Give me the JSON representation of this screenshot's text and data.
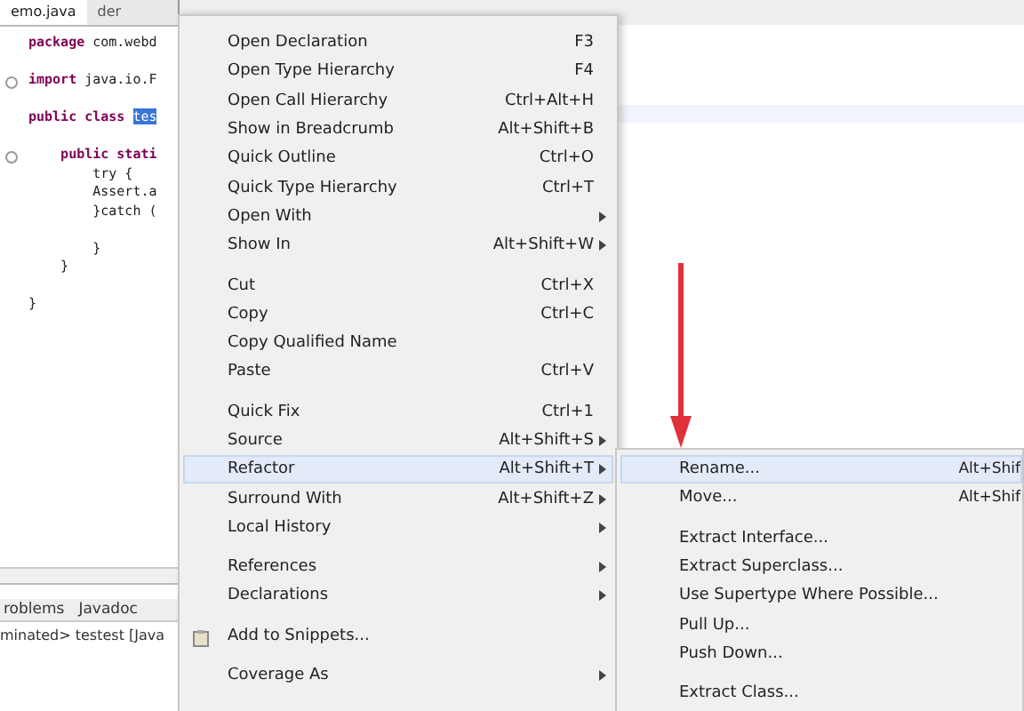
{
  "editor": {
    "tabs": [
      {
        "label": "emo.java",
        "selected": true
      },
      {
        "label": "der",
        "selected": false
      }
    ],
    "lines": [
      {
        "fold": false,
        "segments": [
          {
            "text": "package",
            "kind": "keyword"
          },
          {
            "text": " com.webd",
            "kind": "plain"
          }
        ]
      },
      {
        "kind": "blank"
      },
      {
        "fold": true,
        "segments": [
          {
            "text": "import",
            "kind": "keyword"
          },
          {
            "text": " java.io.F",
            "kind": "plain"
          }
        ]
      },
      {
        "kind": "blank"
      },
      {
        "fold": false,
        "segments": [
          {
            "text": "public class ",
            "kind": "keyword"
          },
          {
            "text": "tes",
            "kind": "selection"
          }
        ]
      },
      {
        "kind": "blank"
      },
      {
        "fold": true,
        "segments": [
          {
            "text": "    public stati",
            "kind": "keyword"
          }
        ]
      },
      {
        "fold": false,
        "segments": [
          {
            "text": "        try {",
            "kind": "plain"
          }
        ]
      },
      {
        "fold": false,
        "segments": [
          {
            "text": "        Assert.a",
            "kind": "plain"
          }
        ]
      },
      {
        "fold": false,
        "segments": [
          {
            "text": "        }catch (",
            "kind": "plain"
          }
        ]
      },
      {
        "kind": "blank"
      },
      {
        "fold": false,
        "segments": [
          {
            "text": "        }",
            "kind": "plain"
          }
        ]
      },
      {
        "fold": false,
        "segments": [
          {
            "text": "    }",
            "kind": "plain"
          }
        ]
      },
      {
        "kind": "blank"
      },
      {
        "fold": false,
        "segments": [
          {
            "text": "}",
            "kind": "plain"
          }
        ]
      }
    ]
  },
  "bottom_panel": {
    "tabs": [
      {
        "label": "roblems",
        "selected": false
      },
      {
        "label": "Javadoc",
        "selected": false
      }
    ],
    "console": "minated> testest [Java"
  },
  "context_menu": [
    {
      "kind": "item",
      "label": "Open Declaration",
      "shortcut": "F3",
      "submenu": false,
      "selected": false
    },
    {
      "kind": "item",
      "label": "Open Type Hierarchy",
      "shortcut": "F4",
      "submenu": false,
      "selected": false
    },
    {
      "kind": "item",
      "label": "Open Call Hierarchy",
      "shortcut": "Ctrl+Alt+H",
      "submenu": false,
      "selected": false
    },
    {
      "kind": "item",
      "label": "Show in Breadcrumb",
      "shortcut": "Alt+Shift+B",
      "submenu": false,
      "selected": false
    },
    {
      "kind": "item",
      "label": "Quick Outline",
      "shortcut": "Ctrl+O",
      "submenu": false,
      "selected": false
    },
    {
      "kind": "item",
      "label": "Quick Type Hierarchy",
      "shortcut": "Ctrl+T",
      "submenu": false,
      "selected": false
    },
    {
      "kind": "item",
      "label": "Open With",
      "submenu": true,
      "selected": false
    },
    {
      "kind": "item",
      "label": "Show In",
      "shortcut": "Alt+Shift+W",
      "submenu": true,
      "selected": false
    },
    {
      "kind": "separator"
    },
    {
      "kind": "item",
      "label": "Cut",
      "shortcut": "Ctrl+X",
      "submenu": false,
      "selected": false
    },
    {
      "kind": "item",
      "label": "Copy",
      "shortcut": "Ctrl+C",
      "submenu": false,
      "selected": false
    },
    {
      "kind": "item",
      "label": "Copy Qualified Name",
      "submenu": false,
      "selected": false
    },
    {
      "kind": "item",
      "label": "Paste",
      "shortcut": "Ctrl+V",
      "submenu": false,
      "selected": false
    },
    {
      "kind": "separator"
    },
    {
      "kind": "item",
      "label": "Quick Fix",
      "shortcut": "Ctrl+1",
      "submenu": false,
      "selected": false
    },
    {
      "kind": "item",
      "label": "Source",
      "shortcut": "Alt+Shift+S",
      "submenu": true,
      "selected": false
    },
    {
      "kind": "item",
      "label": "Refactor",
      "shortcut": "Alt+Shift+T",
      "submenu": true,
      "selected": true
    },
    {
      "kind": "item",
      "label": "Surround With",
      "shortcut": "Alt+Shift+Z",
      "submenu": true,
      "selected": false
    },
    {
      "kind": "item",
      "label": "Local History",
      "submenu": true,
      "selected": false
    },
    {
      "kind": "separator"
    },
    {
      "kind": "item",
      "label": "References",
      "submenu": true,
      "selected": false
    },
    {
      "kind": "item",
      "label": "Declarations",
      "submenu": true,
      "selected": false
    },
    {
      "kind": "separator"
    },
    {
      "kind": "icon_item",
      "label": "Add to Snippets...",
      "submenu": false,
      "selected": false
    },
    {
      "kind": "separator"
    },
    {
      "kind": "item",
      "label": "Coverage As",
      "submenu": true,
      "selected": false
    }
  ],
  "refactor_submenu": [
    {
      "kind": "item",
      "label": "Rename...",
      "shortcut": "Alt+Shif",
      "selected": true
    },
    {
      "kind": "item",
      "label": "Move...",
      "shortcut": "Alt+Shif",
      "selected": false
    },
    {
      "kind": "separator"
    },
    {
      "kind": "item",
      "label": "Extract Interface...",
      "selected": false
    },
    {
      "kind": "item",
      "label": "Extract Superclass...",
      "selected": false
    },
    {
      "kind": "item",
      "label": "Use Supertype Where Possible...",
      "selected": false
    },
    {
      "kind": "item",
      "label": "Pull Up...",
      "selected": false
    },
    {
      "kind": "item",
      "label": "Push Down...",
      "selected": false
    },
    {
      "kind": "separator"
    },
    {
      "kind": "item",
      "label": "Extract Class...",
      "selected": false
    }
  ]
}
